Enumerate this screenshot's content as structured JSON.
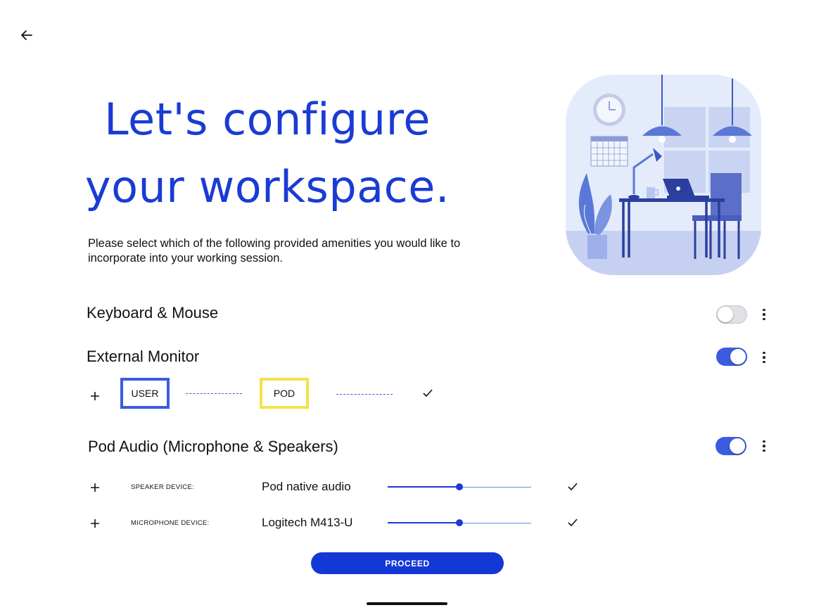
{
  "header": {
    "title_line1": "Let's configure",
    "title_line2": "your workspace.",
    "subtitle": "Please select which of the following provided amenities you would like to incorporate into your working session."
  },
  "amenities": {
    "keyboard_mouse": {
      "label": "Keyboard & Mouse",
      "enabled": false
    },
    "external_monitor": {
      "label": "External Monitor",
      "enabled": true,
      "user_label": "USER",
      "pod_label": "POD"
    },
    "pod_audio": {
      "label": "Pod Audio (Microphone & Speakers)",
      "enabled": true,
      "speaker": {
        "label": "SPEAKER DEVICE:",
        "device": "Pod native audio",
        "volume": 0.5
      },
      "microphone": {
        "label": "MICROPHONE DEVICE:",
        "device": "Logitech M413-U",
        "volume": 0.5
      }
    }
  },
  "actions": {
    "proceed_label": "PROCEED"
  },
  "icons": {
    "back": "arrow-left-icon",
    "more": "more-vert-icon",
    "add": "plus-icon",
    "check": "check-icon"
  },
  "colors": {
    "accent": "#1a3bd4",
    "toggle_on": "#3b5ce0",
    "user_box": "#3b5ce0",
    "pod_box": "#f5e14a",
    "button": "#1438d6"
  }
}
